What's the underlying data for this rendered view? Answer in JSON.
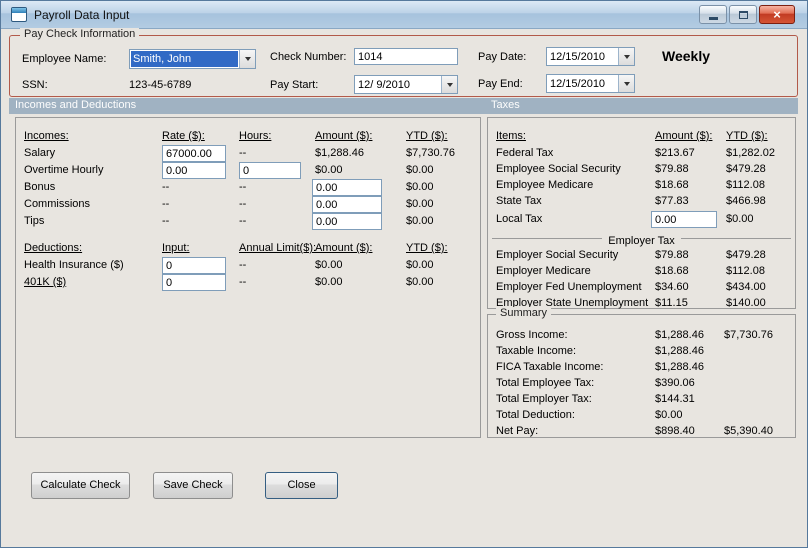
{
  "window": {
    "title": "Payroll Data Input"
  },
  "icons": {
    "close_glyph": "×"
  },
  "paycheck": {
    "group_label": "Pay Check Information",
    "employee_name_label": "Employee Name:",
    "employee_name_value": "Smith, John",
    "ssn_label": "SSN:",
    "ssn_value": "123-45-6789",
    "check_number_label": "Check Number:",
    "check_number_value": "1014",
    "pay_start_label": "Pay Start:",
    "pay_start_value": "12/ 9/2010",
    "pay_date_label": "Pay Date:",
    "pay_date_value": "12/15/2010",
    "pay_end_label": "Pay End:",
    "pay_end_value": "12/15/2010",
    "frequency": "Weekly"
  },
  "sections": {
    "incomes": "Incomes and Deductions",
    "taxes": "Taxes"
  },
  "incomes": {
    "headers": {
      "name": "Incomes:",
      "rate": "Rate ($):",
      "hours": "Hours:",
      "amount": "Amount ($):",
      "ytd": "YTD ($):"
    },
    "rows": [
      {
        "name": "Salary",
        "rate": "67000.00",
        "hours": "--",
        "amount": "$1,288.46",
        "ytd": "$7,730.76"
      },
      {
        "name": "Overtime Hourly",
        "rate": "0.00",
        "hours": "0",
        "amount": "$0.00",
        "ytd": "$0.00"
      },
      {
        "name": "Bonus",
        "rate": "--",
        "hours": "--",
        "amount": "0.00",
        "ytd": "$0.00"
      },
      {
        "name": "Commissions",
        "rate": "--",
        "hours": "--",
        "amount": "0.00",
        "ytd": "$0.00"
      },
      {
        "name": "Tips",
        "rate": "--",
        "hours": "--",
        "amount": "0.00",
        "ytd": "$0.00"
      }
    ]
  },
  "deductions": {
    "headers": {
      "name": "Deductions:",
      "input": "Input:",
      "limit": "Annual Limit($):",
      "amount": "Amount ($):",
      "ytd": "YTD ($):"
    },
    "rows": [
      {
        "name": "Health Insurance  ($)",
        "input": "0",
        "limit": "--",
        "amount": "$0.00",
        "ytd": "$0.00"
      },
      {
        "name": "401K  ($)",
        "input": "0",
        "limit": "--",
        "amount": "$0.00",
        "ytd": "$0.00"
      }
    ]
  },
  "taxes": {
    "headers": {
      "item": "Items:",
      "amount": "Amount ($):",
      "ytd": "YTD ($):"
    },
    "employee_rows": [
      {
        "item": "Federal Tax",
        "amount": "$213.67",
        "ytd": "$1,282.02"
      },
      {
        "item": "Employee Social Security",
        "amount": "$79.88",
        "ytd": "$479.28"
      },
      {
        "item": "Employee Medicare",
        "amount": "$18.68",
        "ytd": "$112.08"
      },
      {
        "item": "State Tax",
        "amount": "$77.83",
        "ytd": "$466.98"
      },
      {
        "item": "Local Tax",
        "amount": "0.00",
        "ytd": "$0.00"
      }
    ],
    "employer_header": "Employer Tax",
    "employer_rows": [
      {
        "item": "Employer Social Security",
        "amount": "$79.88",
        "ytd": "$479.28"
      },
      {
        "item": "Employer Medicare",
        "amount": "$18.68",
        "ytd": "$112.08"
      },
      {
        "item": "Employer Fed Unemployment",
        "amount": "$34.60",
        "ytd": "$434.00"
      },
      {
        "item": "Employer State Unemployment",
        "amount": "$11.15",
        "ytd": "$140.00"
      }
    ]
  },
  "summary": {
    "group_label": "Summary",
    "rows": [
      {
        "label": "Gross Income:",
        "value": "$1,288.46",
        "ytd": "$7,730.76"
      },
      {
        "label": "Taxable Income:",
        "value": "$1,288.46",
        "ytd": ""
      },
      {
        "label": "FICA Taxable Income:",
        "value": "$1,288.46",
        "ytd": ""
      },
      {
        "label": "Total Employee Tax:",
        "value": "$390.06",
        "ytd": ""
      },
      {
        "label": "Total Employer Tax:",
        "value": "$144.31",
        "ytd": ""
      },
      {
        "label": "Total Deduction:",
        "value": "$0.00",
        "ytd": ""
      },
      {
        "label": "Net Pay:",
        "value": "$898.40",
        "ytd": "$5,390.40"
      }
    ]
  },
  "buttons": {
    "calculate": "Calculate Check",
    "save": "Save Check",
    "close": "Close"
  }
}
